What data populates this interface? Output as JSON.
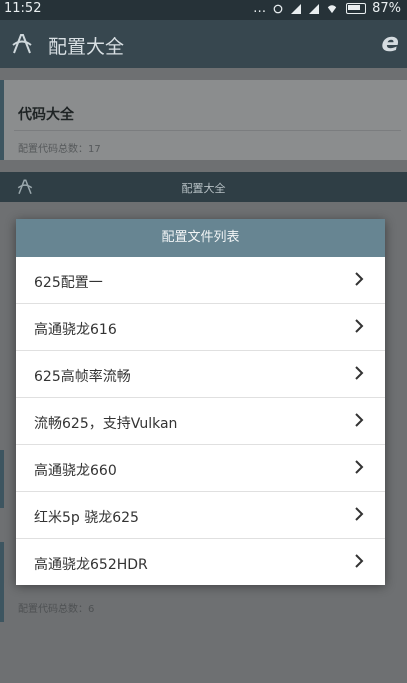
{
  "status_bar": {
    "time": "11:52",
    "battery": "87%"
  },
  "app_bar": {
    "title": "配置大全",
    "brand_icon": "e-logo-icon"
  },
  "background": {
    "card_title": "代码大全",
    "card_count": "配置代码总数：17",
    "sub_bar_title": "配置大全",
    "bottom_count": "配置代码总数：6"
  },
  "dialog": {
    "title": "配置文件列表",
    "items": [
      {
        "label": "625配置一"
      },
      {
        "label": "高通骁龙616"
      },
      {
        "label": "625高帧率流畅"
      },
      {
        "label": "流畅625，支持Vulkan"
      },
      {
        "label": "高通骁龙660"
      },
      {
        "label": "红米5p 骁龙625"
      },
      {
        "label": "高通骁龙652HDR"
      }
    ]
  }
}
